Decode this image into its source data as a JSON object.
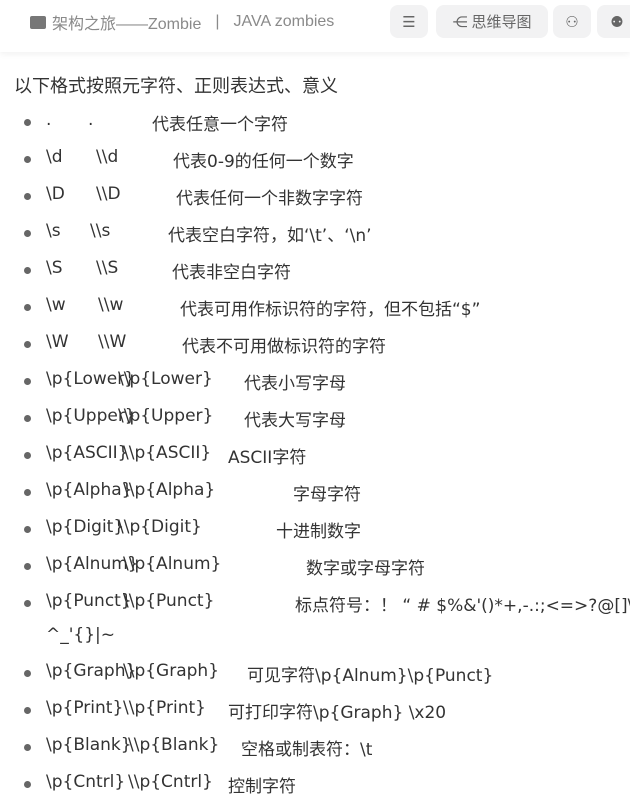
{
  "header": {
    "breadcrumb": "架构之旅——Zombie",
    "separator": "|",
    "book": "JAVA zombies",
    "outline_icon": "search-list-icon",
    "mindmap_label": "思维导图",
    "graph_icon": "graph-icon",
    "users_icon": "users-icon"
  },
  "intro": "以下格式按照元字符、正则表达式、意义",
  "items": [
    {
      "meta": ".",
      "regex": ".",
      "desc": "代表任意一个字符"
    },
    {
      "meta": "\\d",
      "regex": "\\\\d",
      "desc": "代表0-9的任何一个数字"
    },
    {
      "meta": "\\D",
      "regex": "\\\\D",
      "desc": "代表任何一个非数字字符"
    },
    {
      "meta": "\\s",
      "regex": "\\\\s",
      "desc": "代表空白字符，如‘\\t’、‘\\n’"
    },
    {
      "meta": "\\S",
      "regex": "\\\\S",
      "desc": "代表非空白字符"
    },
    {
      "meta": "\\w",
      "regex": "\\\\w",
      "desc": "代表可用作标识符的字符，但不包括“$”"
    },
    {
      "meta": "\\W",
      "regex": "\\\\W",
      "desc": "代表不可用做标识符的字符"
    },
    {
      "meta": "\\p{Lower}",
      "regex": "\\\\p{Lower}",
      "desc": "代表小写字母"
    },
    {
      "meta": "\\p{Upper}",
      "regex": "\\\\p{Upper}",
      "desc": "代表大写字母"
    },
    {
      "meta": "\\p{ASCII}",
      "regex": "\\\\p{ASCII}",
      "desc": "ASCII字符"
    },
    {
      "meta": "\\p{Alpha}",
      "regex": "\\\\p{Alpha}",
      "desc": "字母字符"
    },
    {
      "meta": "\\p{Digit}",
      "regex": "\\\\p{Digit}",
      "desc": "十进制数字"
    },
    {
      "meta": "\\p{Alnum}",
      "regex": "\\\\p{Alnum}",
      "desc": "数字或字母字符"
    },
    {
      "meta": "\\p{Punct}",
      "regex": "\\\\p{Punct}",
      "desc": "标点符号：！ “ # $%&'()*+,-.:;<=>?@[]\\",
      "desc2": "^_'{}|~"
    },
    {
      "meta": "\\p{Graph}",
      "regex": "\\\\p{Graph}",
      "desc": "可见字符\\p{Alnum}\\p{Punct}"
    },
    {
      "meta": "\\p{Print}",
      "regex": "\\\\p{Print}",
      "desc": "可打印字符\\p{Graph} \\x20"
    },
    {
      "meta": "\\p{Blank}",
      "regex": "\\\\p{Blank}",
      "desc": "空格或制表符：\\t"
    },
    {
      "meta": "\\p{Cntrl}",
      "regex": "\\\\p{Cntrl}",
      "desc": "控制字符"
    }
  ]
}
